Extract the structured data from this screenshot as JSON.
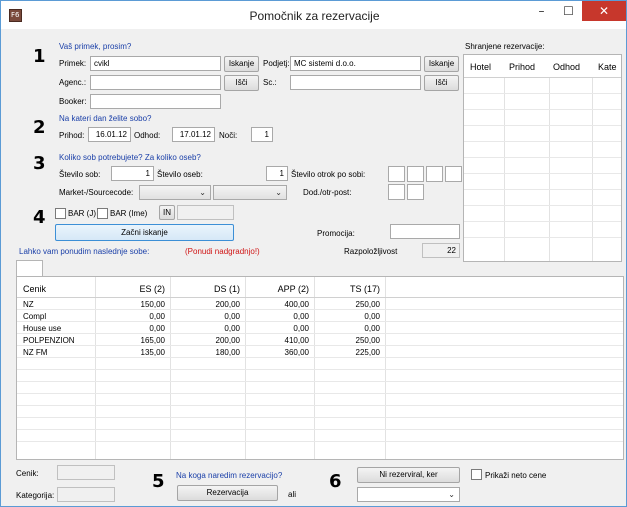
{
  "window": {
    "title": "Pomočnik za rezervacije",
    "minimize": "–",
    "maximize": "☐",
    "close": "✕"
  },
  "section1": {
    "number": "1",
    "heading": "Vaš primek, prosim?",
    "primek_label": "Primek:",
    "primek_value": "cvikl",
    "iskanje1": "Iskanje",
    "podjetje_label": "Podjetj:",
    "podjetje_value": "MC sistemi d.o.o.",
    "iskanje2": "Iskanje",
    "agenc_label": "Agenc.:",
    "isci1": "Išči",
    "sc_label": "Sc.:",
    "isci2": "Išči",
    "booker_label": "Booker:"
  },
  "section2": {
    "number": "2",
    "heading": "Na kateri dan želite sobo?",
    "prihod_label": "Prihod:",
    "prihod_value": "16.01.12",
    "odhod_label": "Odhod:",
    "odhod_value": "17.01.12",
    "noci_label": "Noči:",
    "noci_value": "1"
  },
  "section3": {
    "number": "3",
    "heading": "Koliko sob potrebujete? Za koliko oseb?",
    "sob_label": "Število sob:",
    "sob_value": "1",
    "oseb_label": "Število oseb:",
    "oseb_value": "1",
    "otrok_label": "Število otrok po sobi:",
    "market_label": "Market-/Sourcecode:",
    "dod_label": "Dod./otr-post:"
  },
  "section4": {
    "number": "4",
    "bar_j": "BAR (J)",
    "bar_ime": "BAR (Ime)",
    "in_label": "IN",
    "search_button": "Začni iskanje",
    "promocija_label": "Promocija:",
    "razpolozljivost_label": "Razpoložljivost",
    "razpolozljivost_value": "22"
  },
  "saved": {
    "title": "Shranjene rezervacije:",
    "columns": [
      "Hotel",
      "Prihod",
      "Odhod",
      "Kate"
    ]
  },
  "offer": {
    "text": "Lahko vam ponudim naslednje sobe:",
    "upgrade": "(Ponudi nadgradnjo!)"
  },
  "grid": {
    "columns": [
      "Cenik",
      "ES (2)",
      "DS (1)",
      "APP (2)",
      "TS (17)"
    ],
    "rows": [
      [
        "NZ",
        "150,00",
        "200,00",
        "400,00",
        "250,00"
      ],
      [
        "Compl",
        "0,00",
        "0,00",
        "0,00",
        "0,00"
      ],
      [
        "House use",
        "0,00",
        "0,00",
        "0,00",
        "0,00"
      ],
      [
        "POLPENZION",
        "165,00",
        "200,00",
        "410,00",
        "250,00"
      ],
      [
        "NZ FM",
        "135,00",
        "180,00",
        "360,00",
        "225,00"
      ]
    ]
  },
  "bottom": {
    "cenik_label": "Cenik:",
    "kategorija_label": "Kategorija:",
    "num5": "5",
    "question": "Na koga naredim rezervacijo?",
    "rez_button": "Rezervacija",
    "ali": "ali",
    "num6": "6",
    "ni_rez_button": "Ni rezerviral, ker",
    "neto_label": "Prikaži neto cene"
  }
}
